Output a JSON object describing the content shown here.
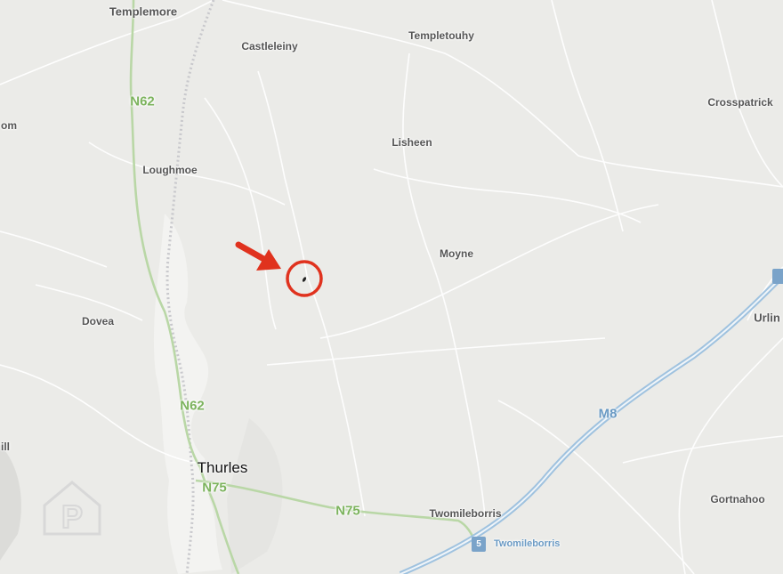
{
  "map": {
    "place_labels": [
      {
        "id": "templemore",
        "text": "Templemore"
      },
      {
        "id": "castleleiny",
        "text": "Castleleiny"
      },
      {
        "id": "templetouhy",
        "text": "Templetouhy"
      },
      {
        "id": "crosspatrick",
        "text": "Crosspatrick"
      },
      {
        "id": "om",
        "text": "om"
      },
      {
        "id": "lisheen",
        "text": "Lisheen"
      },
      {
        "id": "loughmoe",
        "text": "Loughmoe"
      },
      {
        "id": "moyne",
        "text": "Moyne"
      },
      {
        "id": "dovea",
        "text": "Dovea"
      },
      {
        "id": "urlin",
        "text": "Urlin"
      },
      {
        "id": "ill",
        "text": "ill"
      },
      {
        "id": "twomileborris",
        "text": "Twomileborris"
      },
      {
        "id": "gortnahoo",
        "text": "Gortnahoo"
      }
    ],
    "major_town": "Thurles",
    "road_labels": {
      "n62_north": "N62",
      "n62_south": "N62",
      "n75_west": "N75",
      "n75_east": "N75",
      "m8": "M8"
    },
    "motorway_exit": {
      "number": "5",
      "name": "Twomileborris"
    },
    "marker": {
      "type": "location-circle",
      "color": "#e0321e"
    },
    "watermark": "P"
  }
}
